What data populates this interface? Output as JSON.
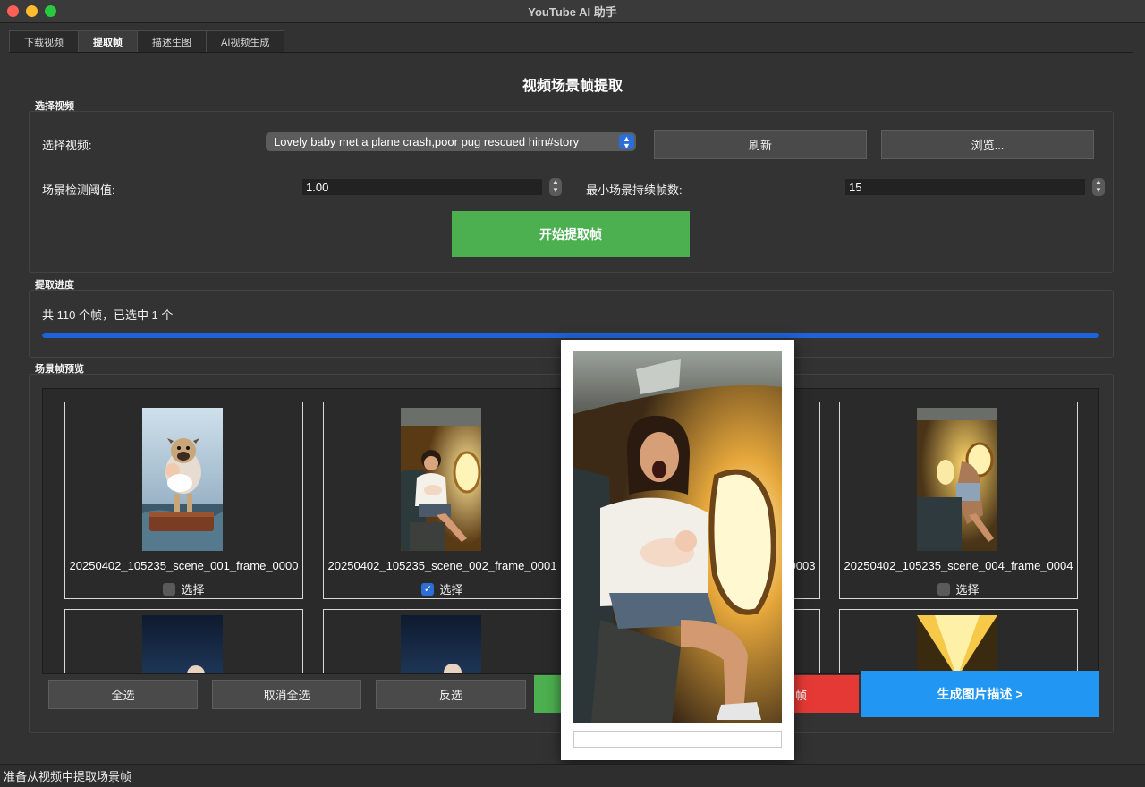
{
  "window": {
    "title": "YouTube AI 助手"
  },
  "tabs": [
    {
      "label": "下载视频",
      "active": false
    },
    {
      "label": "提取帧",
      "active": true
    },
    {
      "label": "描述生图",
      "active": false
    },
    {
      "label": "AI视频生成",
      "active": false
    }
  ],
  "page_title": "视频场景帧提取",
  "select_group": {
    "title": "选择视频",
    "video_label": "选择视频:",
    "video_value": "Lovely baby met a plane crash,poor pug rescued him#story",
    "refresh_label": "刷新",
    "browse_label": "浏览...",
    "threshold_label": "场景检测阈值:",
    "threshold_value": "1.00",
    "min_frames_label": "最小场景持续帧数:",
    "min_frames_value": "15",
    "start_label": "开始提取帧"
  },
  "progress_group": {
    "title": "提取进度",
    "status": "共 110 个帧，已选中 1 个",
    "progress": 1.0
  },
  "preview_group": {
    "title": "场景帧预览",
    "frames": [
      {
        "filename": "20250402_105235_scene_001_frame_0000",
        "checkbox_label": "选择",
        "checked": false
      },
      {
        "filename": "20250402_105235_scene_002_frame_0001",
        "checkbox_label": "选择",
        "checked": true
      },
      {
        "filename": "20250402_105235_scene_003_frame_0003",
        "checkbox_label": "选择",
        "checked": false
      },
      {
        "filename": "20250402_105235_scene_004_frame_0004",
        "checkbox_label": "选择",
        "checked": false
      }
    ]
  },
  "actions": {
    "select_all": "全选",
    "deselect_all": "取消全选",
    "invert": "反选",
    "delete_partial": "帧",
    "next": "生成图片描述 >"
  },
  "status_bar": "准备从视频中提取场景帧",
  "colors": {
    "accent_green": "#4caf50",
    "accent_blue": "#2196f3",
    "accent_red": "#e53935",
    "progress_blue": "#1f63d8"
  }
}
